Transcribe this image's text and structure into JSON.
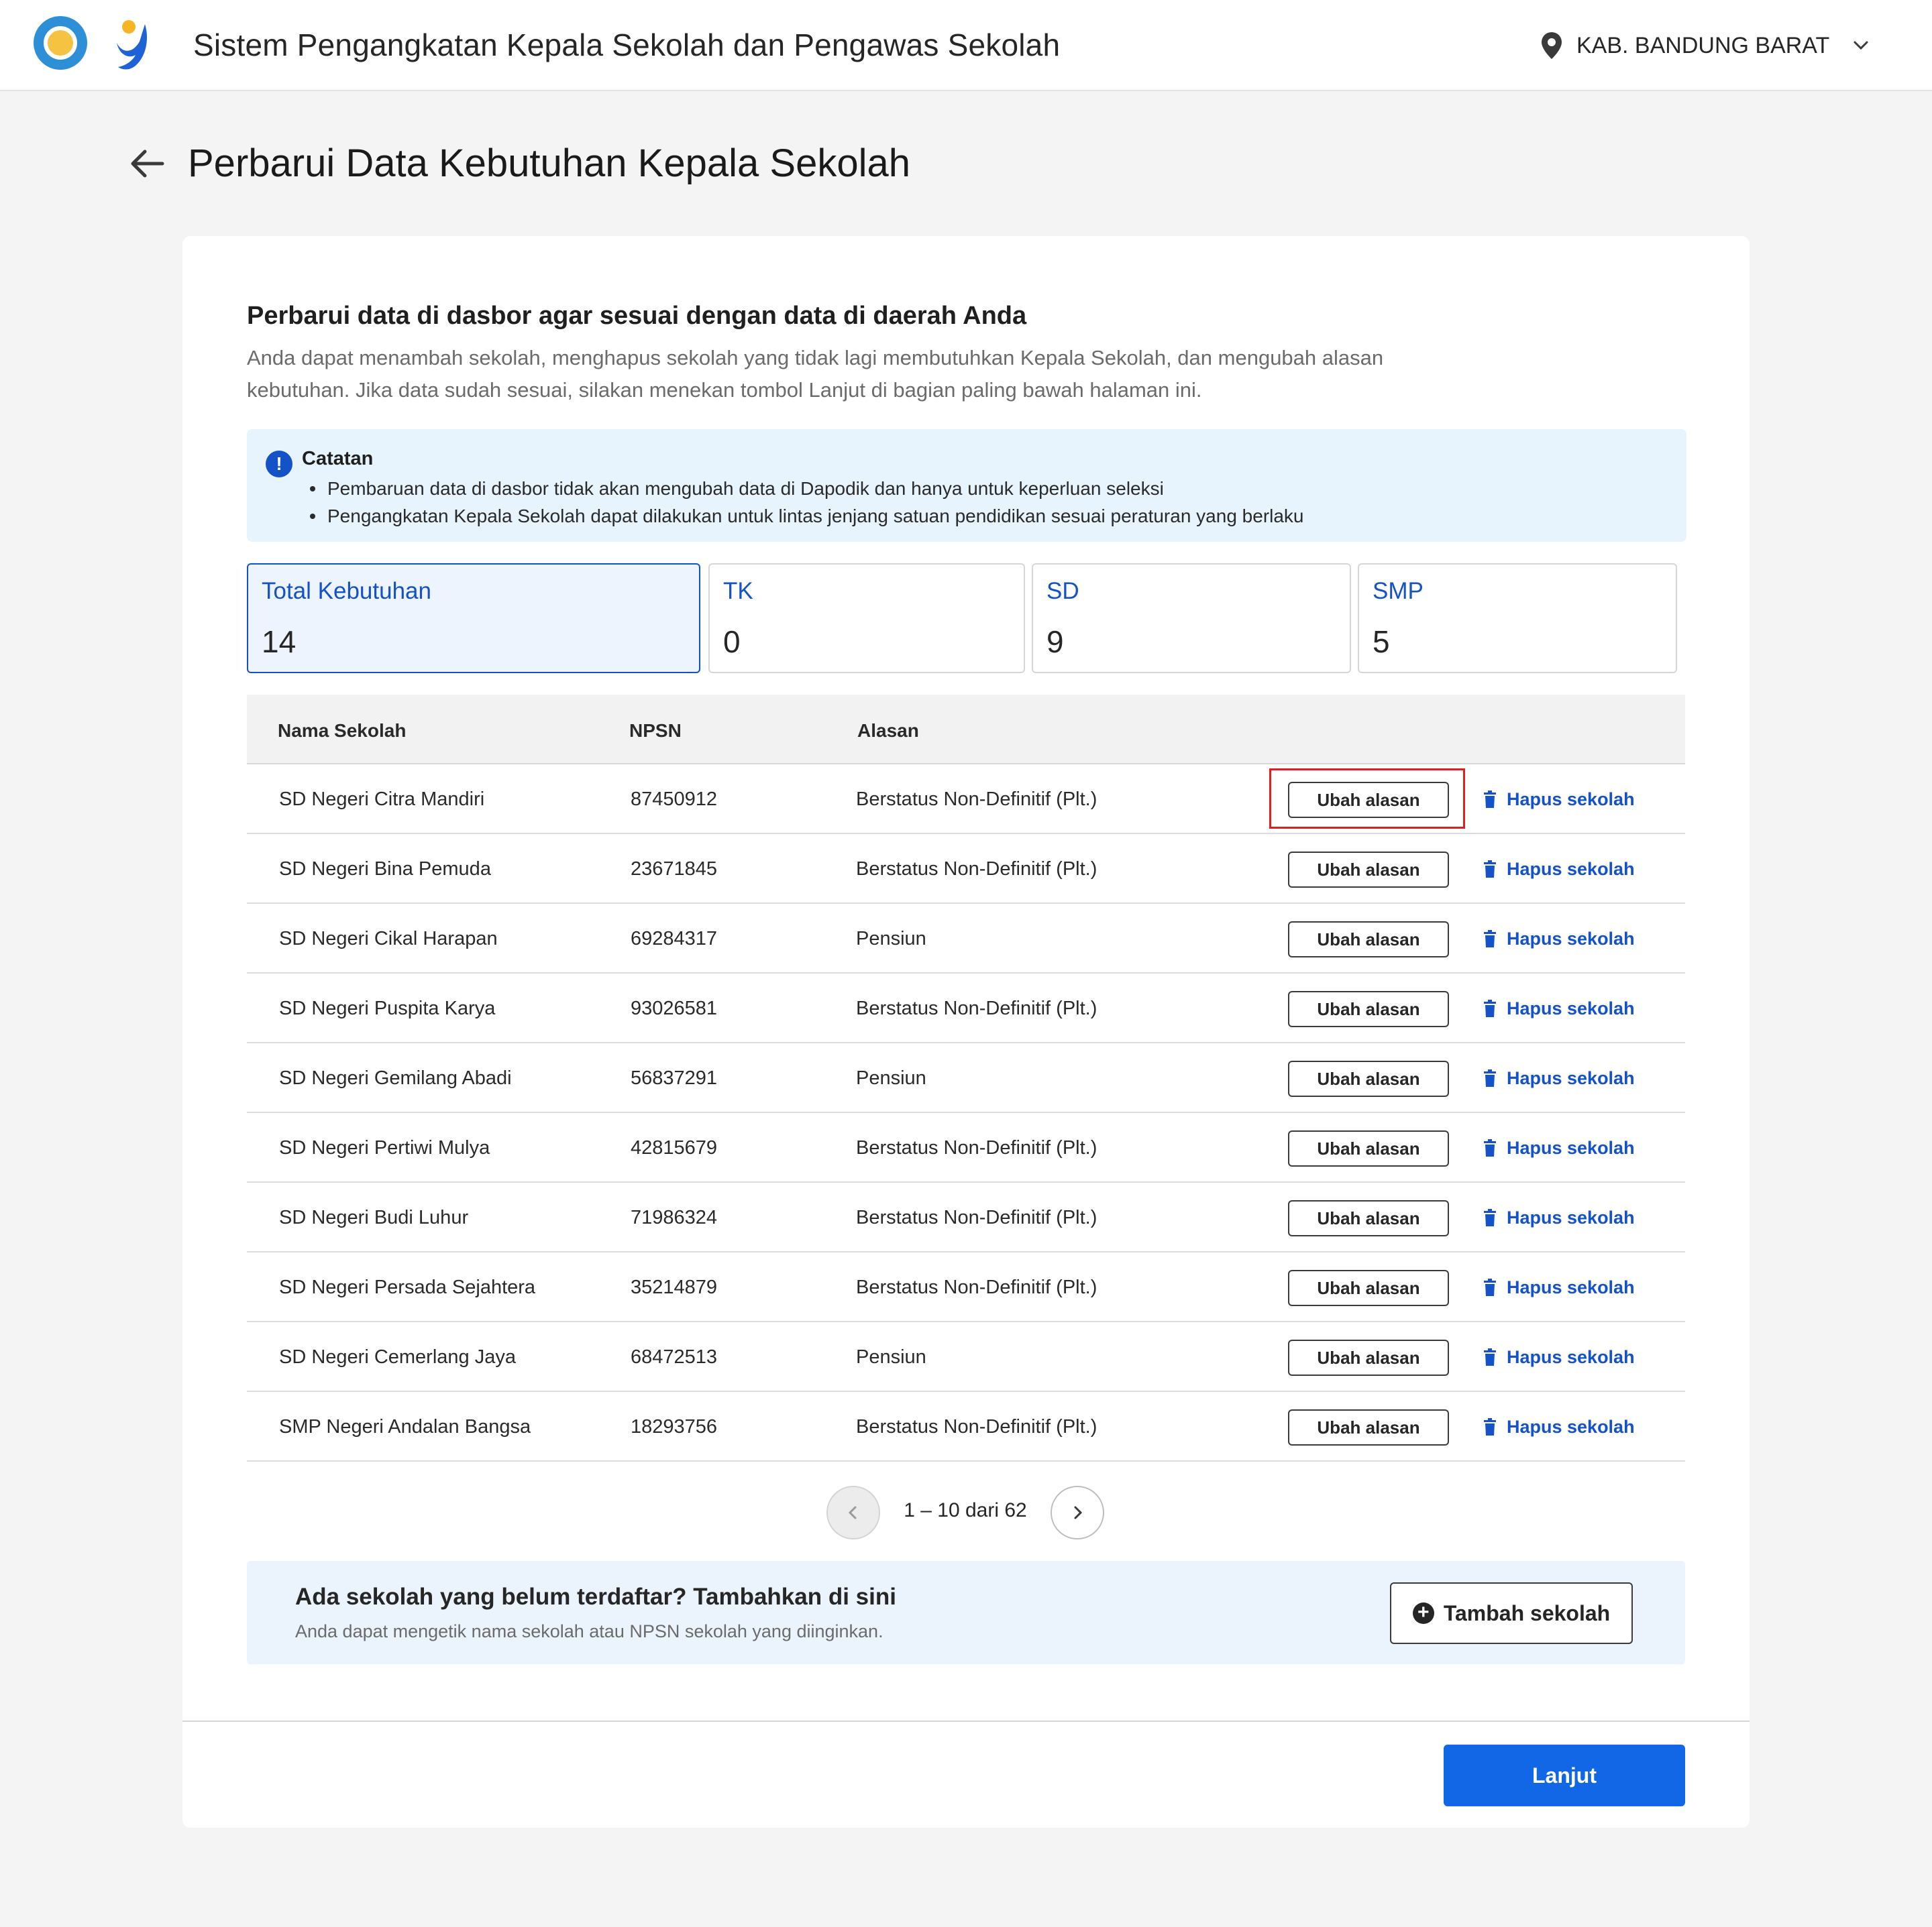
{
  "header": {
    "app_title": "Sistem Pengangkatan Kepala Sekolah dan Pengawas Sekolah",
    "region": "KAB. BANDUNG BARAT",
    "icons": [
      "tut-wuri-logo",
      "brand-logo",
      "location-pin-icon",
      "chevron-down-icon"
    ]
  },
  "page": {
    "title": "Perbarui Data Kebutuhan Kepala Sekolah"
  },
  "intro": {
    "title": "Perbarui data di dasbor agar sesuai dengan data di daerah Anda",
    "description": "Anda dapat menambah sekolah, menghapus sekolah yang tidak lagi membutuhkan Kepala Sekolah, dan mengubah alasan kebutuhan. Jika data sudah sesuai, silakan menekan tombol Lanjut di bagian paling bawah halaman ini."
  },
  "note": {
    "title": "Catatan",
    "items": [
      "Pembaruan data di dasbor tidak akan mengubah data di Dapodik dan hanya untuk keperluan seleksi",
      "Pengangkatan Kepala Sekolah dapat dilakukan untuk lintas jenjang satuan pendidikan sesuai peraturan yang berlaku"
    ]
  },
  "stats": [
    {
      "label": "Total Kebutuhan",
      "value": "14"
    },
    {
      "label": "TK",
      "value": "0"
    },
    {
      "label": "SD",
      "value": "9"
    },
    {
      "label": "SMP",
      "value": "5"
    }
  ],
  "table": {
    "headers": {
      "name": "Nama Sekolah",
      "npsn": "NPSN",
      "reason": "Alasan"
    },
    "edit_label": "Ubah alasan",
    "delete_label": "Hapus sekolah",
    "rows": [
      {
        "name": "SD Negeri Citra Mandiri",
        "npsn": "87450912",
        "reason": "Berstatus Non-Definitif (Plt.)"
      },
      {
        "name": "SD Negeri Bina Pemuda",
        "npsn": "23671845",
        "reason": "Berstatus Non-Definitif (Plt.)"
      },
      {
        "name": "SD Negeri Cikal Harapan",
        "npsn": "69284317",
        "reason": "Pensiun"
      },
      {
        "name": "SD Negeri Puspita Karya",
        "npsn": "93026581",
        "reason": "Berstatus Non-Definitif (Plt.)"
      },
      {
        "name": "SD Negeri Gemilang Abadi",
        "npsn": "56837291",
        "reason": "Pensiun"
      },
      {
        "name": "SD Negeri Pertiwi Mulya",
        "npsn": "42815679",
        "reason": "Berstatus Non-Definitif (Plt.)"
      },
      {
        "name": "SD Negeri Budi Luhur",
        "npsn": "71986324",
        "reason": "Berstatus Non-Definitif (Plt.)"
      },
      {
        "name": "SD Negeri Persada Sejahtera",
        "npsn": "35214879",
        "reason": "Berstatus Non-Definitif (Plt.)"
      },
      {
        "name": "SD Negeri Cemerlang Jaya",
        "npsn": "68472513",
        "reason": "Pensiun"
      },
      {
        "name": "SMP Negeri Andalan Bangsa",
        "npsn": "18293756",
        "reason": "Berstatus Non-Definitif (Plt.)"
      }
    ]
  },
  "pagination": {
    "info": "1 – 10 dari 62"
  },
  "add_school": {
    "title": "Ada sekolah yang belum terdaftar? Tambahkan di sini",
    "description": "Anda dapat mengetik nama sekolah atau NPSN sekolah yang diinginkan.",
    "button_label": "Tambah sekolah"
  },
  "footer": {
    "next_label": "Lanjut"
  },
  "colors": {
    "primary": "#1167e5",
    "link": "#1452c8",
    "highlight": "#e02020",
    "note_bg": "#e7f3fd"
  }
}
